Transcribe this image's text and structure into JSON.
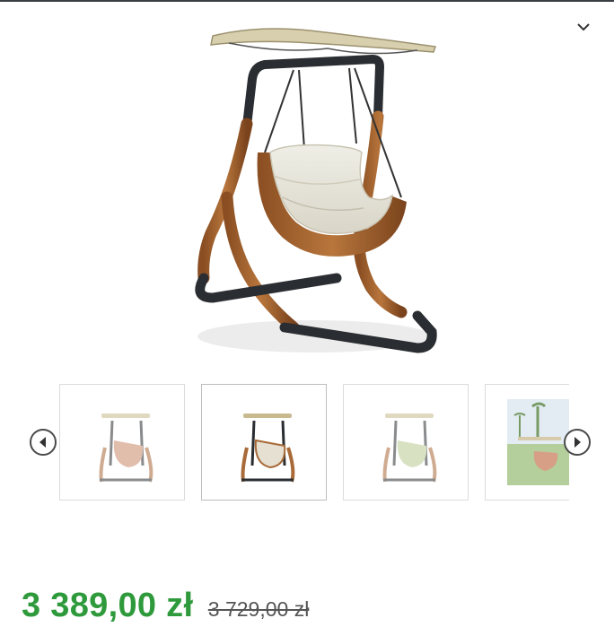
{
  "gallery": {
    "collapse_icon": "chevron-down-icon",
    "prev_icon": "chevron-left-icon",
    "next_icon": "chevron-right-icon",
    "thumbnails": [
      {
        "variant": "terracotta cushion",
        "cushion_color": "#c98a6a",
        "selected": false
      },
      {
        "variant": "beige cushion",
        "cushion_color": "#e6e0d2",
        "selected": true
      },
      {
        "variant": "green cushion",
        "cushion_color": "#b9cc93",
        "selected": false
      },
      {
        "variant": "garden scene",
        "cushion_color": "#c97f5e",
        "selected": false
      }
    ]
  },
  "pricing": {
    "current": "3 389,00 zł",
    "old": "3 729,00 zł",
    "current_color": "#2e9a3c"
  }
}
